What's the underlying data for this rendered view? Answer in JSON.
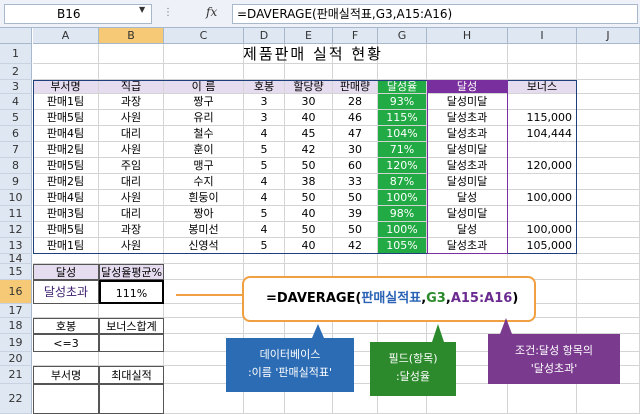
{
  "formula_bar": {
    "name_box": "B16",
    "dots": "⋮",
    "fx": "fx",
    "formula": "=DAVERAGE(판매실적표,G3,A15:A16)"
  },
  "columns": [
    "A",
    "B",
    "C",
    "D",
    "E",
    "F",
    "G",
    "H",
    "I",
    "J"
  ],
  "rows": [
    "1",
    "2",
    "3",
    "4",
    "5",
    "6",
    "7",
    "8",
    "9",
    "10",
    "11",
    "12",
    "13",
    "14",
    "15",
    "16",
    "17",
    "18",
    "19",
    "20",
    "21",
    "22"
  ],
  "title": "제품판매 실적 현황",
  "table": {
    "headers": [
      "부서명",
      "직급",
      "이 름",
      "호봉",
      "할당량",
      "판매량",
      "달성율",
      "달성",
      "보너스"
    ],
    "rows": [
      [
        "판매1팀",
        "과장",
        "짱구",
        "3",
        "30",
        "28",
        "93%",
        "달성미달",
        ""
      ],
      [
        "판매5팀",
        "사원",
        "유리",
        "3",
        "40",
        "46",
        "115%",
        "달성초과",
        "115,000"
      ],
      [
        "판매4팀",
        "대리",
        "철수",
        "4",
        "45",
        "47",
        "104%",
        "달성초과",
        "104,444"
      ],
      [
        "판매2팀",
        "사원",
        "훈이",
        "5",
        "42",
        "30",
        "71%",
        "달성미달",
        ""
      ],
      [
        "판매5팀",
        "주임",
        "맹구",
        "5",
        "50",
        "60",
        "120%",
        "달성초과",
        "120,000"
      ],
      [
        "판매2팀",
        "대리",
        "수지",
        "4",
        "38",
        "33",
        "87%",
        "달성미달",
        ""
      ],
      [
        "판매4팀",
        "사원",
        "흰둥이",
        "4",
        "50",
        "50",
        "100%",
        "달성",
        "100,000"
      ],
      [
        "판매3팀",
        "대리",
        "짱아",
        "5",
        "40",
        "39",
        "98%",
        "달성미달",
        ""
      ],
      [
        "판매5팀",
        "과장",
        "봉미선",
        "4",
        "50",
        "50",
        "100%",
        "달성",
        "100,000"
      ],
      [
        "판매1팀",
        "사원",
        "신영석",
        "5",
        "40",
        "42",
        "105%",
        "달성초과",
        "105,000"
      ]
    ]
  },
  "criteria1": {
    "label": "달성",
    "value": "달성초과",
    "result_label": "달성율평균%",
    "result": "111%"
  },
  "criteria2": {
    "label": "호봉",
    "value": "<=3",
    "result_label": "보너스합계"
  },
  "criteria3": {
    "label": "부서명",
    "result_label": "최대실적"
  },
  "callout": {
    "prefix": "=DAVERAGE(",
    "arg1": "판매실적표",
    "comma1": ",",
    "arg2": "G3",
    "comma2": ",",
    "arg3": "A15:A16",
    "suffix": ")"
  },
  "boxes": {
    "database": [
      "데이터베이스",
      ":이름 '판매실적표'"
    ],
    "field": [
      "필드(항목)",
      ":달성율"
    ],
    "criteria": [
      "조건:달성 항목의",
      "'달성초과'"
    ]
  },
  "colors": {
    "green": "#22aa44",
    "purple": "#7a2f9e",
    "header_lavender": "#e6dcf0",
    "callout_orange": "#f0a040",
    "db_blue": "#2c6cb4"
  }
}
